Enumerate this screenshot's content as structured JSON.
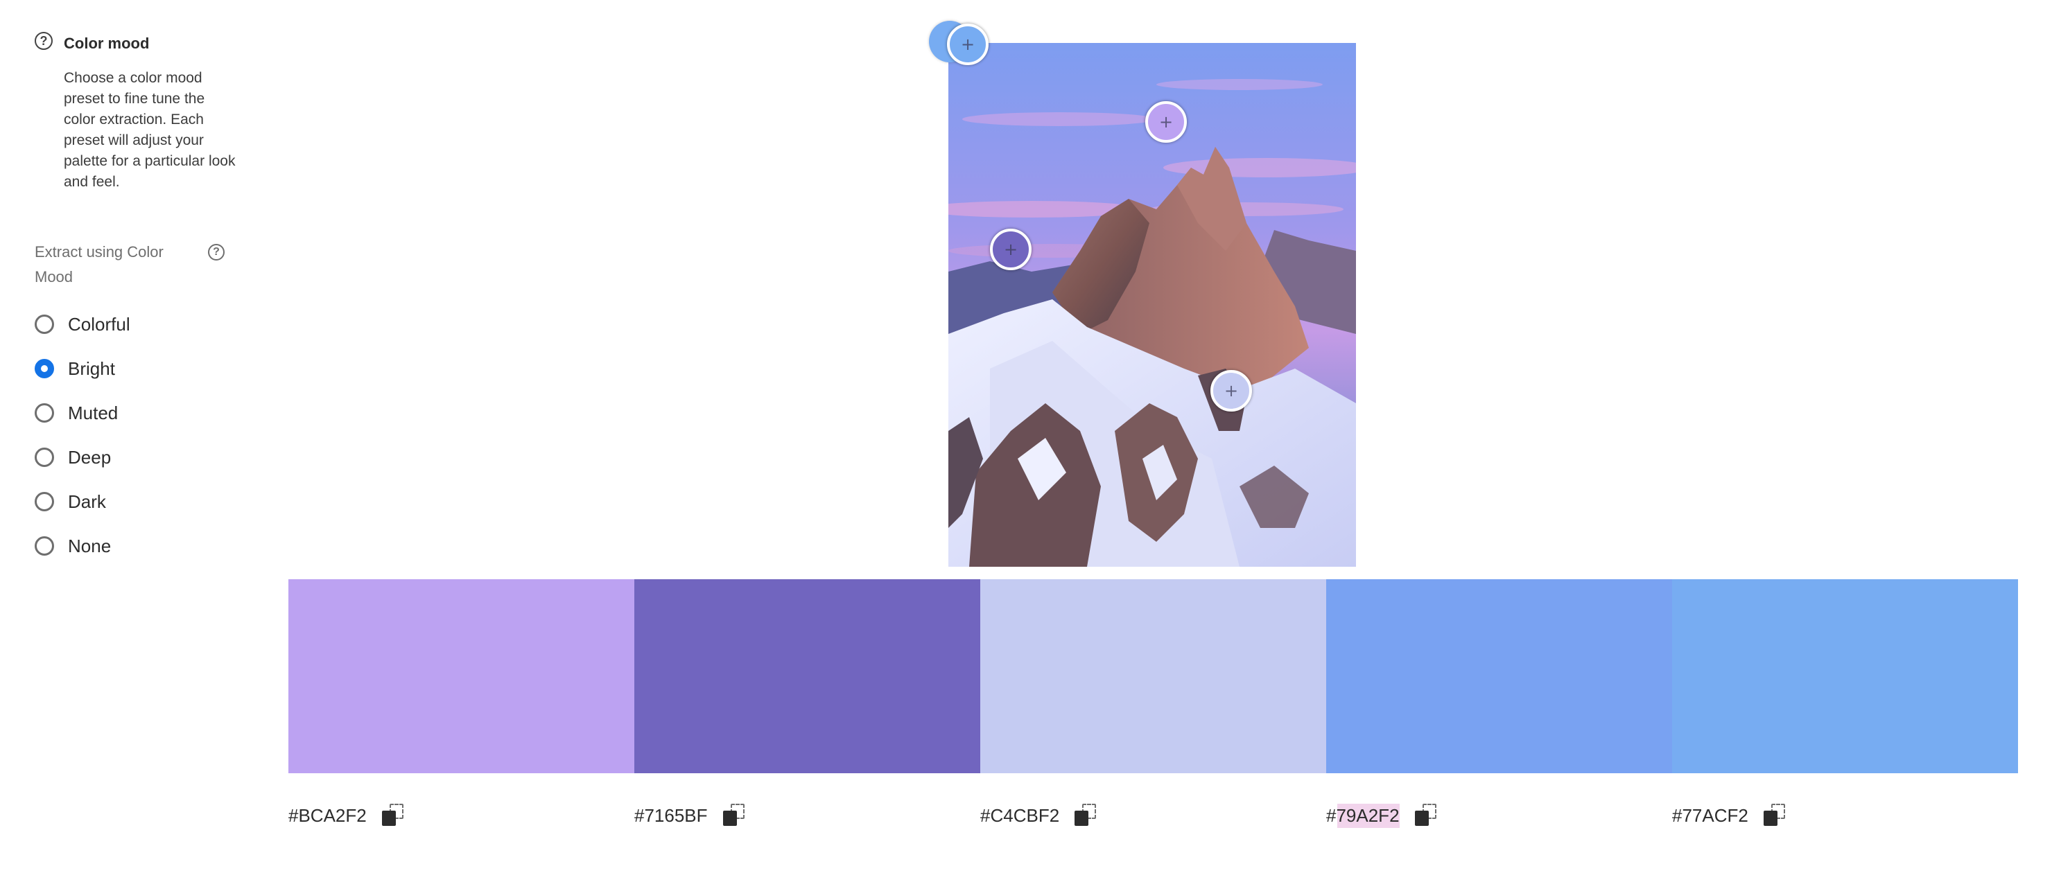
{
  "info": {
    "title": "Color mood",
    "description": "Choose a color mood preset to fine tune the color extraction. Each preset will adjust your palette for a particular look and feel."
  },
  "extract": {
    "label": "Extract using Color Mood",
    "options": [
      {
        "label": "Colorful",
        "selected": false
      },
      {
        "label": "Bright",
        "selected": true
      },
      {
        "label": "Muted",
        "selected": false
      },
      {
        "label": "Deep",
        "selected": false
      },
      {
        "label": "Dark",
        "selected": false
      },
      {
        "label": "None",
        "selected": false
      }
    ]
  },
  "pickers": [
    {
      "color": "#77ACF2"
    },
    {
      "color": "#BCA2F2"
    },
    {
      "color": "#7165BF"
    },
    {
      "color": "#C4CBF2"
    },
    {
      "color": "#79A2F2"
    }
  ],
  "swatches": [
    {
      "color": "#BCA2F2",
      "hex": "#BCA2F2"
    },
    {
      "color": "#7165BF",
      "hex": "#7165BF"
    },
    {
      "color": "#C4CBF2",
      "hex": "#C4CBF2"
    },
    {
      "color": "#79A2F2",
      "hex": "#79A2F2"
    },
    {
      "color": "#77ACF2",
      "hex": "#77ACF2"
    }
  ],
  "icons": {
    "help": "?",
    "picker_plus": "+",
    "copy": "copy-icon"
  },
  "colors": {
    "accent": "#1473e6",
    "text": "#2c2c2c",
    "muted_text": "#6e6e6e",
    "highlight": "#f2d4ec"
  }
}
